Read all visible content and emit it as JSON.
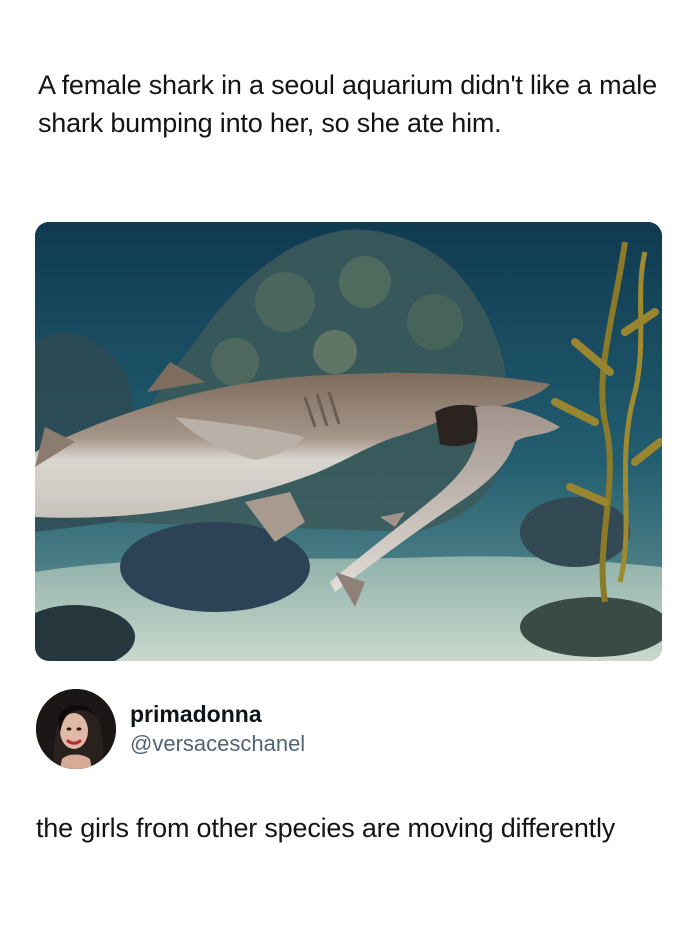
{
  "quoted_post": {
    "text": "A female shark in a seoul aquarium didn't like a male shark bumping into her, so she ate him.",
    "image_description_icon": "shark-photo"
  },
  "reply": {
    "author": {
      "display_name": "primadonna",
      "handle": "@versaceschanel",
      "avatar_icon": "avatar-icon"
    },
    "text": "the girls from other species are moving differently"
  },
  "colors": {
    "text_primary": "#0f1419",
    "text_secondary": "#536471",
    "background": "#ffffff"
  }
}
